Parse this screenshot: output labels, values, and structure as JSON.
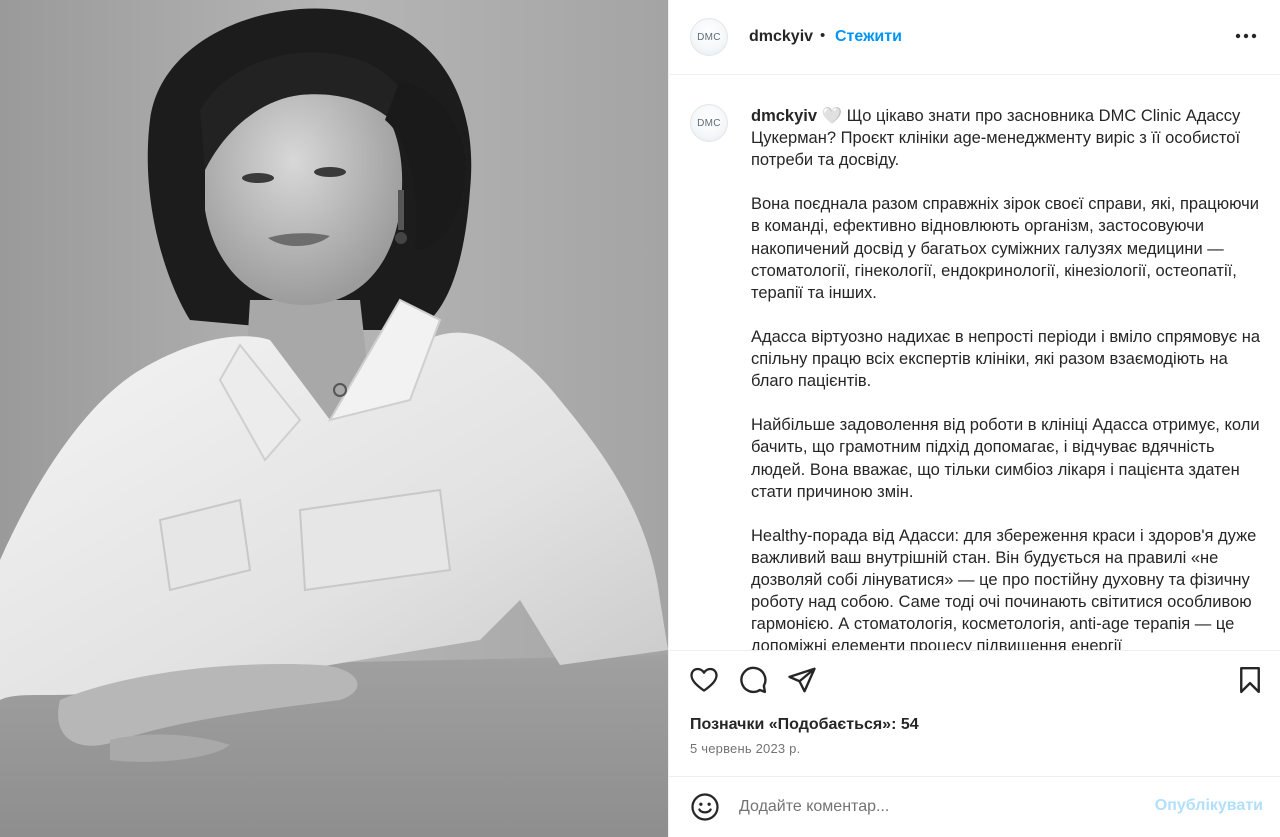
{
  "post": {
    "image_alt": "Чорно-біле фото жінки в білій сорочці"
  },
  "header": {
    "avatar_text": "DMC",
    "username": "dmckyiv",
    "separator": "•",
    "follow_label": "Стежити",
    "more_icon": "more-horizontal-icon"
  },
  "caption": {
    "avatar_text": "DMC",
    "username": "dmckyiv",
    "heart": "🤍",
    "first_text": "Що цікаво знати про засновника DMC Clinic Адассу Цукерман? Проєкт клініки age-менеджменту виріс з її особистої потреби та досвіду.",
    "paragraphs": [
      "Вона поєднала разом справжніх зірок своєї справи, які, працюючи в команді, ефективно відновлюють організм, застосовуючи накопичений досвід у багатьох суміжних галузях медицини — стоматології, гінекології, ендокринології, кінезіології, остеопатії, терапії та інших.",
      "Адасса віртуозно надихає в непрості періоди і вміло спрямовує на спільну працю всіх експертів клініки, які разом взаємодіють на благо пацієнтів.",
      "Найбільше задоволення від роботи в клініці Адасса отримує, коли бачить, що грамотним підхід допомагає, і відчуває вдячність людей. Вона вважає, що тільки симбіоз лікаря і пацієнта здатен стати причиною змін.",
      "Healthy-порада від Адасси: для збереження краси і здоров'я дуже важливий ваш внутрішній стан. Він будується на правилі «не дозволяй собі лінуватися» — це про постійну духовну та фізичну роботу над собою. Саме тоді очі починають світитися особливою гармонією. А стоматологія, косметологія, anti-age терапія — це допоміжні елементи процесу підвищення енергії"
    ]
  },
  "actions": {
    "like_icon": "heart-icon",
    "comment_icon": "comment-icon",
    "share_icon": "share-icon",
    "save_icon": "bookmark-icon"
  },
  "likes_text": "Позначки «Подобається»: 54",
  "date_text": "5 червень 2023 р.",
  "comment": {
    "emoji_icon": "emoji-icon",
    "placeholder": "Додайте коментар...",
    "value": "",
    "publish_label": "Опублікувати"
  },
  "colors": {
    "accent": "#0095f6",
    "publish_disabled": "#b2dffc",
    "text": "#262626",
    "muted": "#737373",
    "divider": "#efefef"
  }
}
